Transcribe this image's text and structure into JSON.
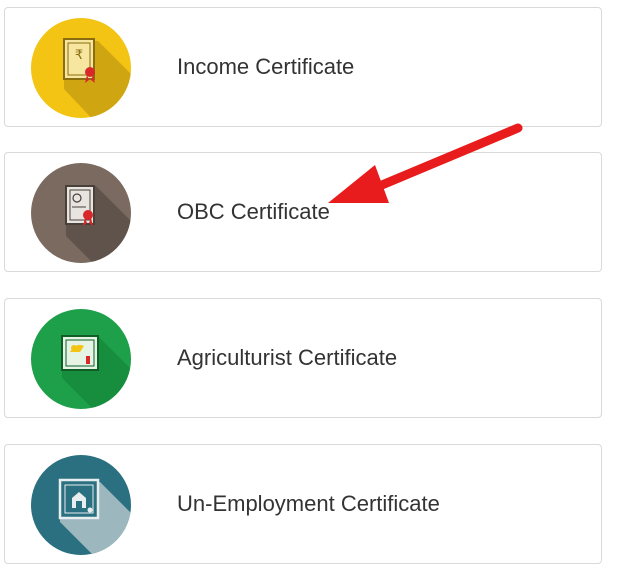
{
  "certificates": [
    {
      "label": "Income Certificate",
      "icon": "income-certificate-icon",
      "color": "#f3c413",
      "shadow": "#c49a10"
    },
    {
      "label": "OBC Certificate",
      "icon": "obc-certificate-icon",
      "color": "#7b6a60",
      "shadow": "#5a4d45"
    },
    {
      "label": "Agriculturist Certificate",
      "icon": "agriculturist-certificate-icon",
      "color": "#1ea04a",
      "shadow": "#157a37"
    },
    {
      "label": "Un-Employment Certificate",
      "icon": "unemployment-certificate-icon",
      "color": "#2b7080",
      "shadow": "#1f5360"
    }
  ],
  "annotation": {
    "icon": "red-arrow-icon",
    "color": "#e81c1c"
  }
}
